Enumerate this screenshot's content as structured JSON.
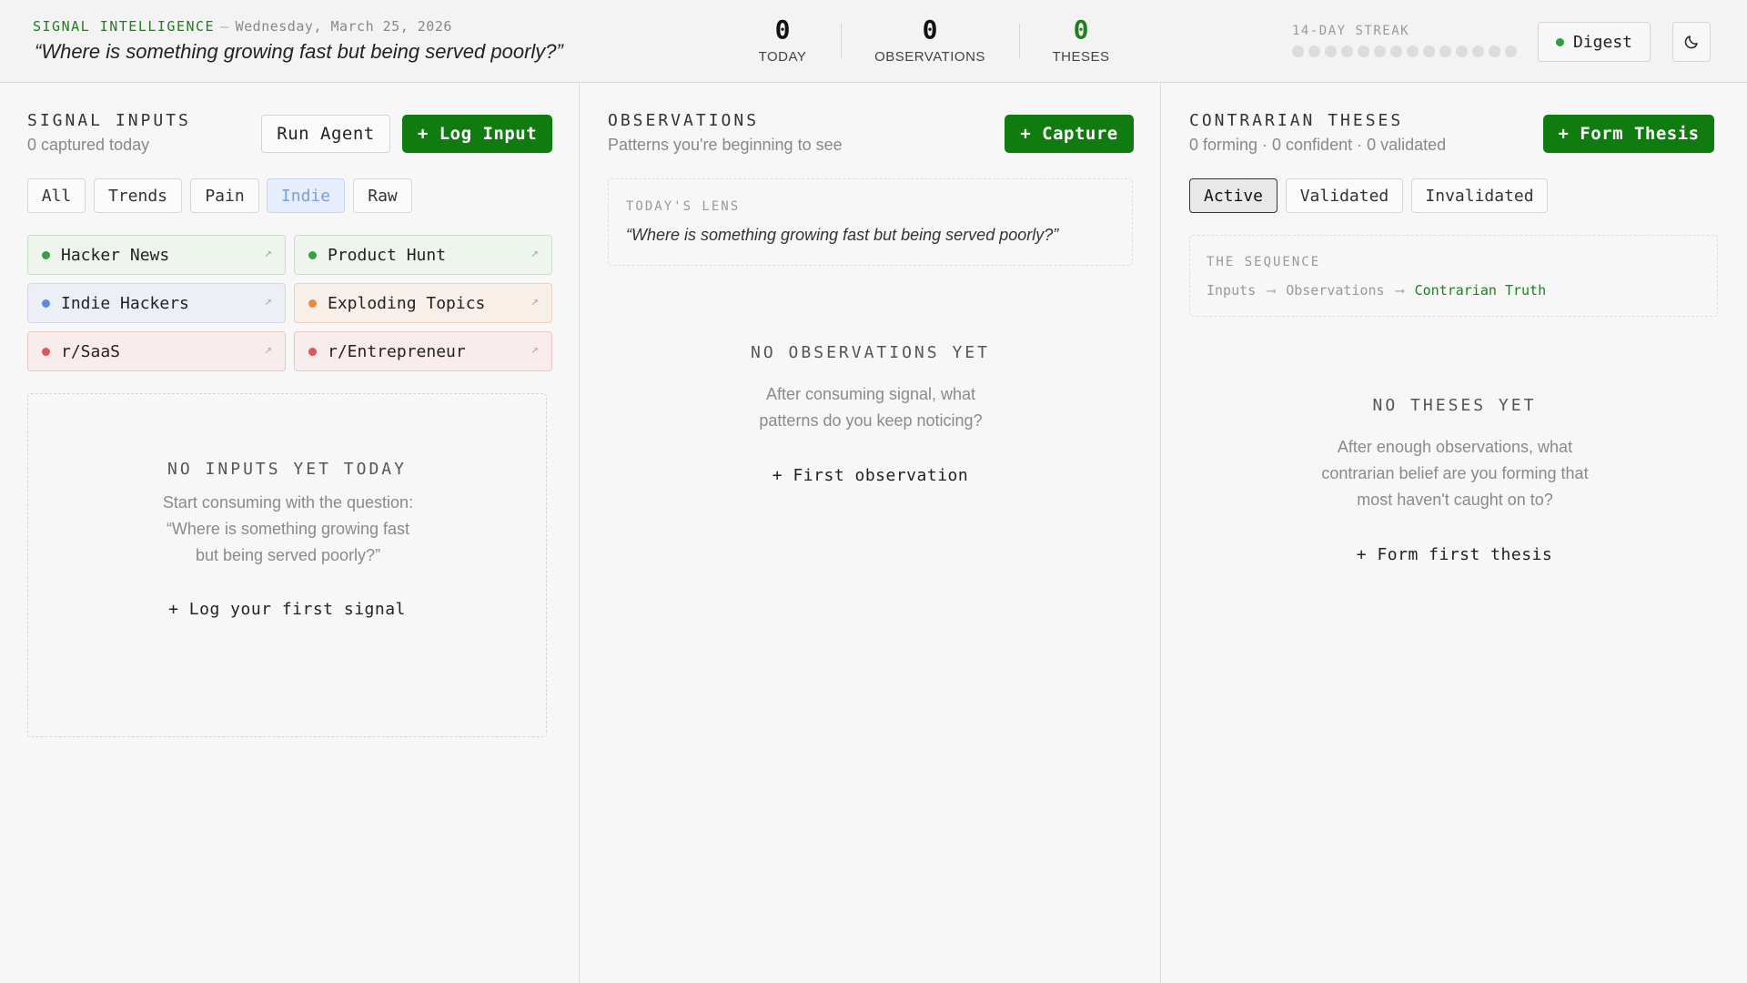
{
  "header": {
    "brand": "SIGNAL INTELLIGENCE",
    "separator": "—",
    "date": "Wednesday, March 25, 2026",
    "quote": "“Where is something growing fast but being served poorly?”",
    "stats": [
      {
        "value": "0",
        "label": "TODAY"
      },
      {
        "value": "0",
        "label": "OBSERVATIONS"
      },
      {
        "value": "0",
        "label": "THESES",
        "color": "#1e7f1e"
      }
    ],
    "streak_label": "14-DAY STREAK",
    "streak_days_completed": 0,
    "streak_days_total": 14,
    "digest_label": "Digest",
    "theme_toggle_icon": "moon-icon"
  },
  "inputs": {
    "title": "SIGNAL INPUTS",
    "subtitle": "0 captured today",
    "run_agent_label": "Run Agent",
    "log_input_label": "+ Log Input",
    "filters": [
      "All",
      "Trends",
      "Pain",
      "Indie",
      "Raw"
    ],
    "active_filter": "Indie",
    "sources": [
      {
        "name": "Hacker News",
        "color": "green"
      },
      {
        "name": "Product Hunt",
        "color": "green"
      },
      {
        "name": "Indie Hackers",
        "color": "blue"
      },
      {
        "name": "Exploding Topics",
        "color": "orange"
      },
      {
        "name": "r/SaaS",
        "color": "red"
      },
      {
        "name": "r/Entrepreneur",
        "color": "red"
      }
    ],
    "source_arrow": "↗",
    "empty_title": "NO INPUTS YET TODAY",
    "empty_text": "Start consuming with the question: “Where is something growing fast but being served poorly?”",
    "empty_link": "+ Log your first signal"
  },
  "observations": {
    "title": "OBSERVATIONS",
    "subtitle": "Patterns you're beginning to see",
    "capture_label": "+ Capture",
    "lens_label": "TODAY'S LENS",
    "lens_quote": "“Where is something growing fast but being served poorly?”",
    "empty_title": "NO OBSERVATIONS YET",
    "empty_text": "After consuming signal, what patterns do you keep noticing?",
    "empty_link": "+ First observation"
  },
  "theses": {
    "title": "CONTRARIAN THESES",
    "subtitle": "0 forming · 0 confident · 0 validated",
    "form_label": "+ Form Thesis",
    "tabs": [
      "Active",
      "Validated",
      "Invalidated"
    ],
    "active_tab": "Active",
    "sequence_label": "THE SEQUENCE",
    "sequence": [
      "Inputs",
      "Observations",
      "Contrarian Truth"
    ],
    "sequence_arrow": "⟶",
    "empty_title": "NO THESES YET",
    "empty_text": "After enough observations, what contrarian belief are you forming that most haven't caught on to?",
    "empty_link": "+ Form first thesis"
  }
}
